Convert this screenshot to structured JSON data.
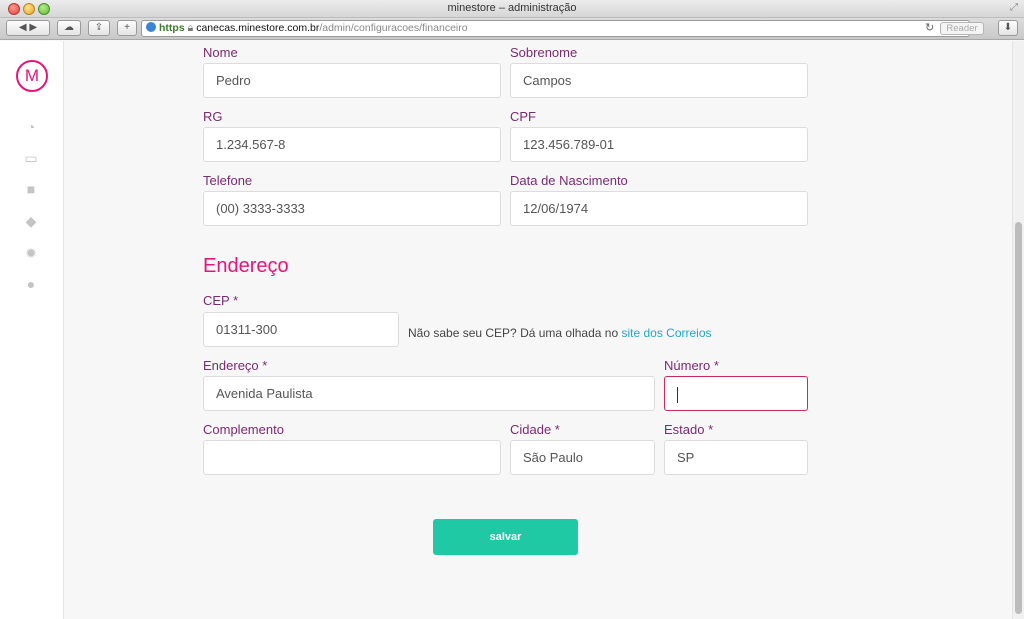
{
  "window": {
    "title": "minestore – administração"
  },
  "toolbar": {
    "url_https": "https",
    "url_host": "canecas.minestore.com.br",
    "url_path": "/admin/configuracoes/financeiro",
    "reader_label": "Reader"
  },
  "sidebar": {
    "logo_letter": "M",
    "icons": [
      "dashboard-icon",
      "inbox-icon",
      "gift-icon",
      "tag-icon",
      "gear-icon",
      "help-icon"
    ]
  },
  "form": {
    "nome": {
      "label": "Nome",
      "value": "Pedro"
    },
    "sobrenome": {
      "label": "Sobrenome",
      "value": "Campos"
    },
    "rg": {
      "label": "RG",
      "value": "1.234.567-8"
    },
    "cpf": {
      "label": "CPF",
      "value": "123.456.789-01"
    },
    "telefone": {
      "label": "Telefone",
      "value": "(00) 3333-3333"
    },
    "nascimento": {
      "label": "Data de Nascimento",
      "value": "12/06/1974"
    }
  },
  "address": {
    "section_title": "Endereço",
    "cep": {
      "label": "CEP *",
      "value": "01311-300"
    },
    "cep_hint": "Não sabe seu CEP? Dá uma olhada no",
    "cep_link": "site dos Correios",
    "endereco": {
      "label": "Endereço *",
      "value": "Avenida Paulista"
    },
    "numero": {
      "label": "Número *",
      "value": ""
    },
    "complemento": {
      "label": "Complemento",
      "value": ""
    },
    "cidade": {
      "label": "Cidade *",
      "value": "São Paulo"
    },
    "estado": {
      "label": "Estado *",
      "value": "SP"
    }
  },
  "actions": {
    "save_label": "salvar"
  },
  "colors": {
    "brand_pink": "#e5157a",
    "label_purple": "#7b2a73",
    "save_green": "#1ec9a3",
    "link_blue": "#1fa8c9"
  }
}
